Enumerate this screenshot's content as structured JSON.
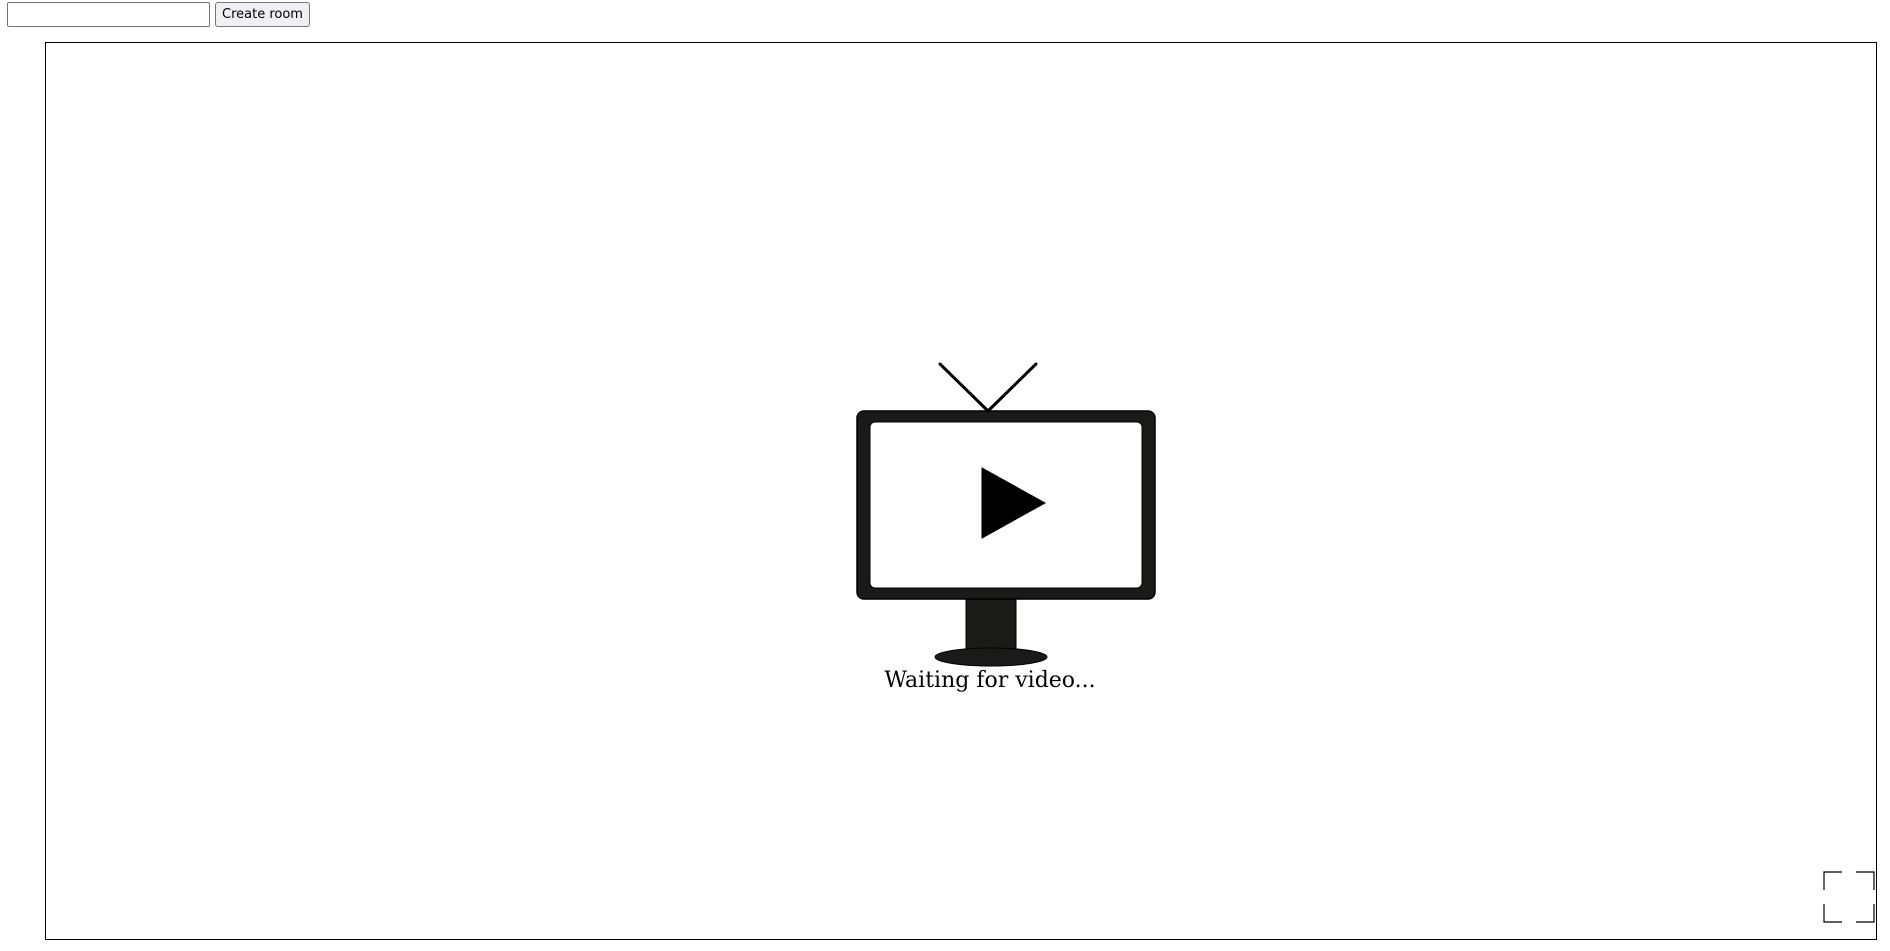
{
  "toolbar": {
    "room_input_value": "",
    "room_input_placeholder": "",
    "create_room_label": "Create room"
  },
  "player": {
    "status_text": "Waiting for video...",
    "icons": {
      "placeholder": "tv-play-icon",
      "fullscreen": "fullscreen-icon"
    }
  },
  "colors": {
    "tv_frame": "#1a1a18",
    "tv_screen": "#ffffff",
    "play_triangle": "#000000",
    "button_bg": "#efeff4",
    "border": "#000000"
  }
}
